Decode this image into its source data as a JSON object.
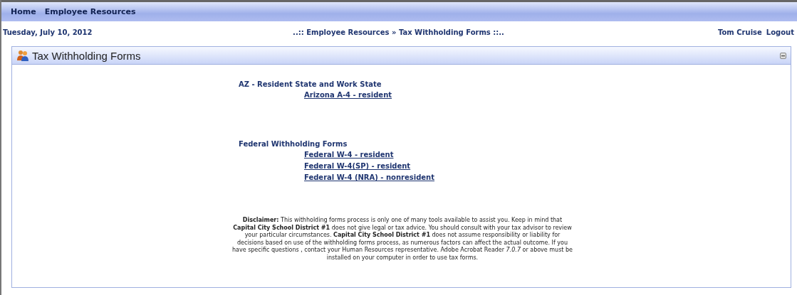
{
  "nav": {
    "items": [
      "Home",
      "Employee Resources"
    ]
  },
  "header": {
    "date": "Tuesday, July 10, 2012",
    "breadcrumb": "..:: Employee Resources » Tax Withholding Forms ::..",
    "user": "Tom Cruise",
    "logout": "Logout"
  },
  "panel": {
    "title": "Tax Withholding Forms",
    "sections": [
      {
        "heading": "AZ - Resident State and Work State",
        "links": [
          "Arizona A-4 - resident"
        ]
      },
      {
        "heading": "Federal Withholding Forms",
        "links": [
          "Federal W-4 - resident",
          "Federal W-4(SP) - resident",
          "Federal W-4 (NRA) - nonresident"
        ]
      }
    ],
    "disclaimer": "**Disclaimer:** This withholding forms process is only one of many tools available to assist you. Keep in mind that **Capital City School District #1** does not give legal or tax advice. You should consult with your tax advisor to review your particular circumstances. **Capital City School District #1** does not assume responsibility or liability for decisions based on use of the withholding forms process, as numerous factors can affect the actual outcome. If you have specific questions , contact your Human Resources representative. Adobe Acrobat Reader *7.0.7* or above must be installed on your computer in order to use tax forms."
  }
}
